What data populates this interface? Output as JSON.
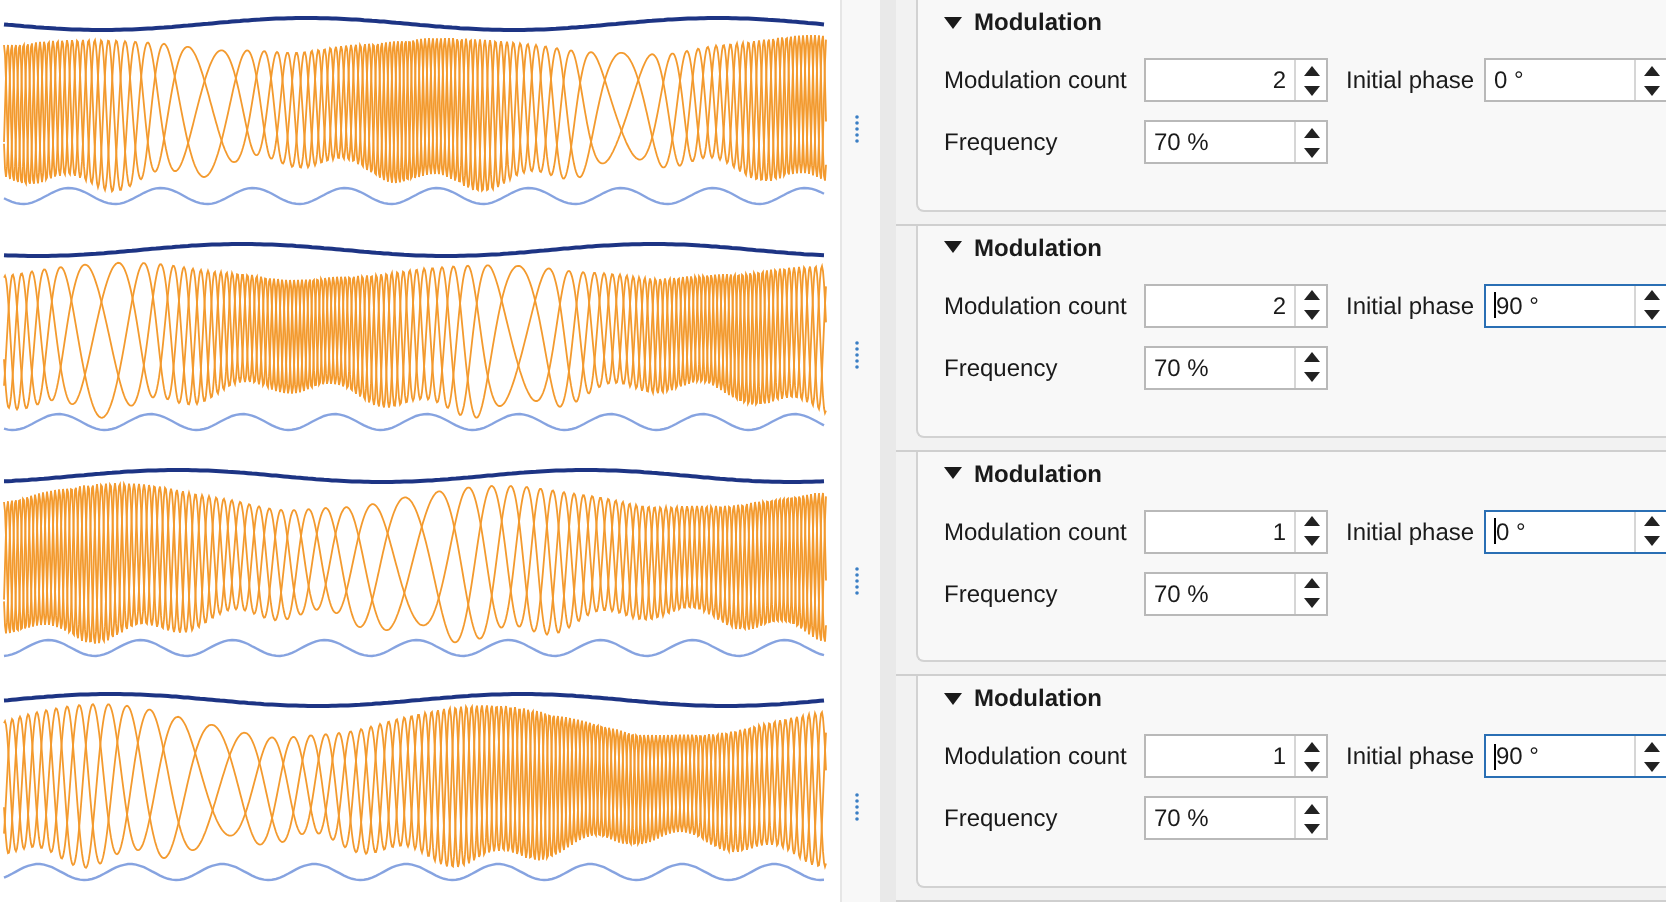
{
  "rows": [
    {
      "section": {
        "title": "Modulation",
        "expanded": true
      },
      "fields": [
        {
          "kind": "integer",
          "label": "Modulation count",
          "value": "2",
          "focused": false
        },
        {
          "kind": "quantity",
          "label": "Initial phase",
          "value": "0 °",
          "focused": false
        },
        {
          "kind": "quantity",
          "label": "Frequency",
          "value": "70 %",
          "focused": false
        }
      ]
    },
    {
      "section": {
        "title": "Modulation",
        "expanded": true
      },
      "fields": [
        {
          "kind": "integer",
          "label": "Modulation count",
          "value": "2",
          "focused": false
        },
        {
          "kind": "quantity",
          "label": "Initial phase",
          "value": "90 °",
          "focused": true
        },
        {
          "kind": "quantity",
          "label": "Frequency",
          "value": "70 %",
          "focused": false
        }
      ]
    },
    {
      "section": {
        "title": "Modulation",
        "expanded": true
      },
      "fields": [
        {
          "kind": "integer",
          "label": "Modulation count",
          "value": "1",
          "focused": false
        },
        {
          "kind": "quantity",
          "label": "Initial phase",
          "value": "0 °",
          "focused": true
        },
        {
          "kind": "quantity",
          "label": "Frequency",
          "value": "70 %",
          "focused": false
        }
      ]
    },
    {
      "section": {
        "title": "Modulation",
        "expanded": true
      },
      "fields": [
        {
          "kind": "integer",
          "label": "Modulation count",
          "value": "1",
          "focused": false
        },
        {
          "kind": "quantity",
          "label": "Initial phase",
          "value": "90 °",
          "focused": true
        },
        {
          "kind": "quantity",
          "label": "Frequency",
          "value": "70 %",
          "focused": false
        }
      ]
    }
  ]
}
